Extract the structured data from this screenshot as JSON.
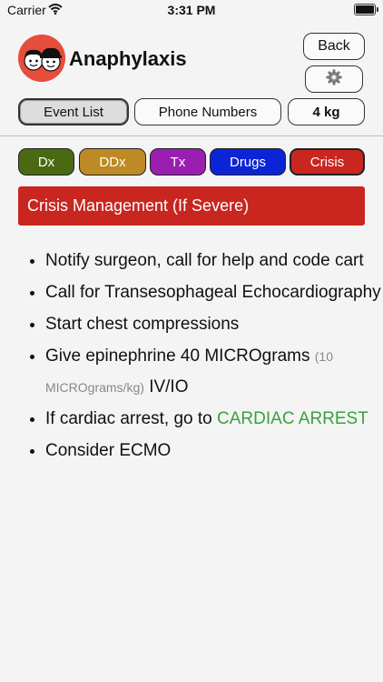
{
  "status_bar": {
    "carrier": "Carrier",
    "time": "3:31 PM"
  },
  "header": {
    "title": "Anaphylaxis",
    "back_label": "Back",
    "settings_icon": "gear-icon",
    "logo": "two-children-faces-logo"
  },
  "nav": {
    "event_list": "Event List",
    "phone_numbers": "Phone Numbers",
    "weight": "4 kg"
  },
  "tabs": [
    {
      "label": "Dx",
      "color": "#4a6a12"
    },
    {
      "label": "DDx",
      "color": "#bd8a25"
    },
    {
      "label": "Tx",
      "color": "#9a1fb0"
    },
    {
      "label": "Drugs",
      "color": "#0b24d6"
    },
    {
      "label": "Crisis",
      "color": "#c8261f"
    }
  ],
  "section": {
    "title": "Crisis Management (If Severe)",
    "color": "#c8261f"
  },
  "items": {
    "notify": "Notify surgeon, call for help and code cart",
    "tee": "Call for Transesophageal Echocardiography",
    "compressions": "Start chest compressions",
    "epi_pre": "Give epinephrine 40 MICROgrams",
    "epi_small": "(10 MICROgrams/kg)",
    "epi_post": "IV/IO",
    "arrest_pre": "If cardiac arrest, go to",
    "arrest_link": "CARDIAC ARREST",
    "ecmo": "Consider ECMO"
  },
  "colors": {
    "link": "#3aa040",
    "logo_bg": "#e64d3d"
  }
}
